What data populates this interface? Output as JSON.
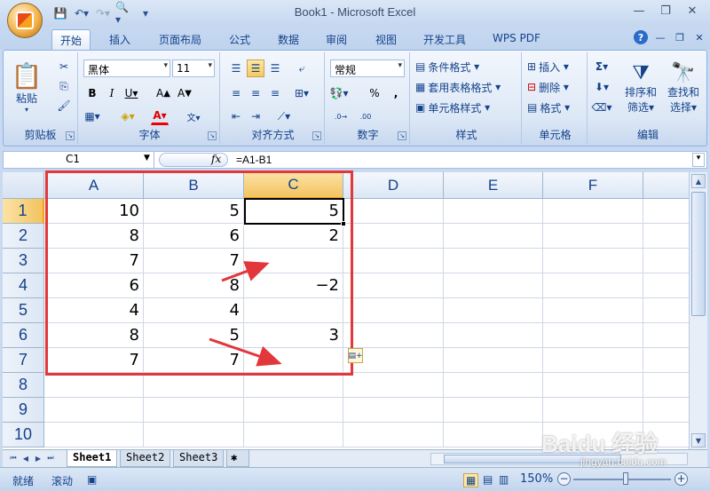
{
  "window": {
    "title": "Book1 - Microsoft Excel"
  },
  "qat": {
    "save_icon": "save-icon",
    "undo_icon": "undo-icon",
    "redo_icon": "redo-icon",
    "preview_icon": "print-preview-icon"
  },
  "tabs": [
    "开始",
    "插入",
    "页面布局",
    "公式",
    "数据",
    "审阅",
    "视图",
    "开发工具",
    "WPS PDF"
  ],
  "ribbon": {
    "clipboard": {
      "label": "剪贴板",
      "paste": "粘贴"
    },
    "font": {
      "label": "字体",
      "name": "黑体",
      "size": "11"
    },
    "alignment": {
      "label": "对齐方式"
    },
    "number": {
      "label": "数字",
      "format": "常规",
      "percent": "%"
    },
    "styles": {
      "label": "样式",
      "conditional": "条件格式",
      "table": "套用表格格式",
      "cell": "单元格样式"
    },
    "cells": {
      "label": "单元格",
      "insert": "插入",
      "delete": "删除",
      "format": "格式"
    },
    "editing": {
      "label": "编辑",
      "sort1": "排序和",
      "sort2": "筛选",
      "find1": "查找和",
      "find2": "选择"
    }
  },
  "formula_bar": {
    "name_box": "C1",
    "fx": "fx",
    "formula": "=A1-B1"
  },
  "columns": [
    "A",
    "B",
    "C",
    "D",
    "E",
    "F"
  ],
  "rows": [
    "1",
    "2",
    "3",
    "4",
    "5",
    "6",
    "7",
    "8",
    "9",
    "10"
  ],
  "cells": [
    [
      "10",
      "5",
      "5"
    ],
    [
      "8",
      "6",
      "2"
    ],
    [
      "7",
      "7",
      ""
    ],
    [
      "6",
      "8",
      "−2"
    ],
    [
      "4",
      "4",
      ""
    ],
    [
      "8",
      "5",
      "3"
    ],
    [
      "7",
      "7",
      ""
    ]
  ],
  "sheets": [
    "Sheet1",
    "Sheet2",
    "Sheet3"
  ],
  "status": {
    "ready": "就绪",
    "scroll": "滚动",
    "zoom": "150%"
  },
  "watermark": {
    "main": "Baidu 经验",
    "sub": "jingyan.baidu.com"
  },
  "colors": {
    "accent": "#e2373b",
    "header_selected": "#f3c35f"
  }
}
